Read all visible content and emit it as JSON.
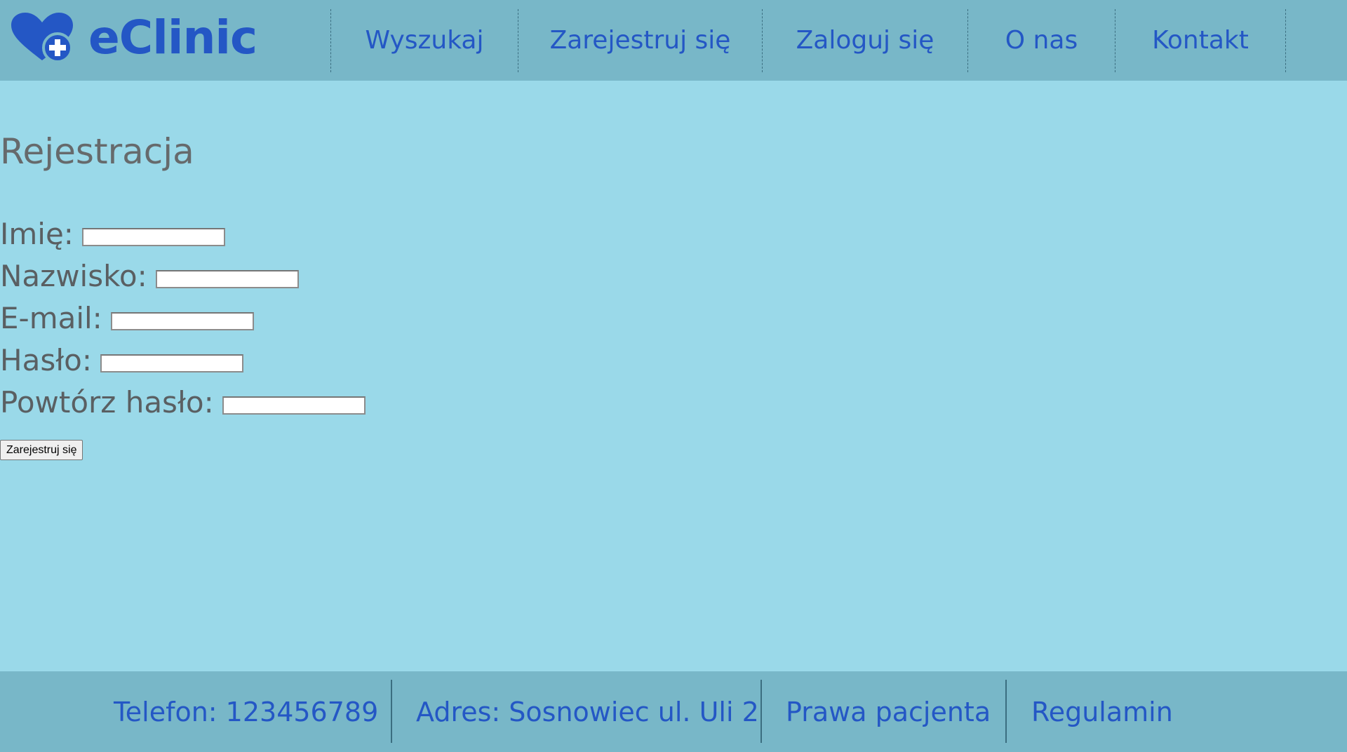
{
  "header": {
    "logo_text": "eClinic",
    "logo_icon": "heart-plus-icon",
    "nav": [
      {
        "label": "Wyszukaj"
      },
      {
        "label": "Zarejestruj się"
      },
      {
        "label": "Zaloguj się"
      },
      {
        "label": "O nas"
      },
      {
        "label": "Kontakt"
      }
    ]
  },
  "main": {
    "title": "Rejestracja",
    "fields": [
      {
        "label": "Imię:",
        "value": "",
        "type": "text"
      },
      {
        "label": "Nazwisko:",
        "value": "",
        "type": "text"
      },
      {
        "label": "E-mail:",
        "value": "",
        "type": "email"
      },
      {
        "label": "Hasło:",
        "value": "",
        "type": "password"
      },
      {
        "label": "Powtórz hasło:",
        "value": "",
        "type": "password"
      }
    ],
    "submit_label": "Zarejestruj się"
  },
  "footer": {
    "phone": "Telefon: 123456789",
    "address": "Adres: Sosnowiec ul. Uli 2",
    "patient_rights": "Prawa pacjenta",
    "terms": "Regulamin"
  },
  "colors": {
    "page_background": "#9ad9e9",
    "bar_background": "#78b7c8",
    "brand_blue": "#2457c5",
    "label_gray": "#5a5f62"
  }
}
